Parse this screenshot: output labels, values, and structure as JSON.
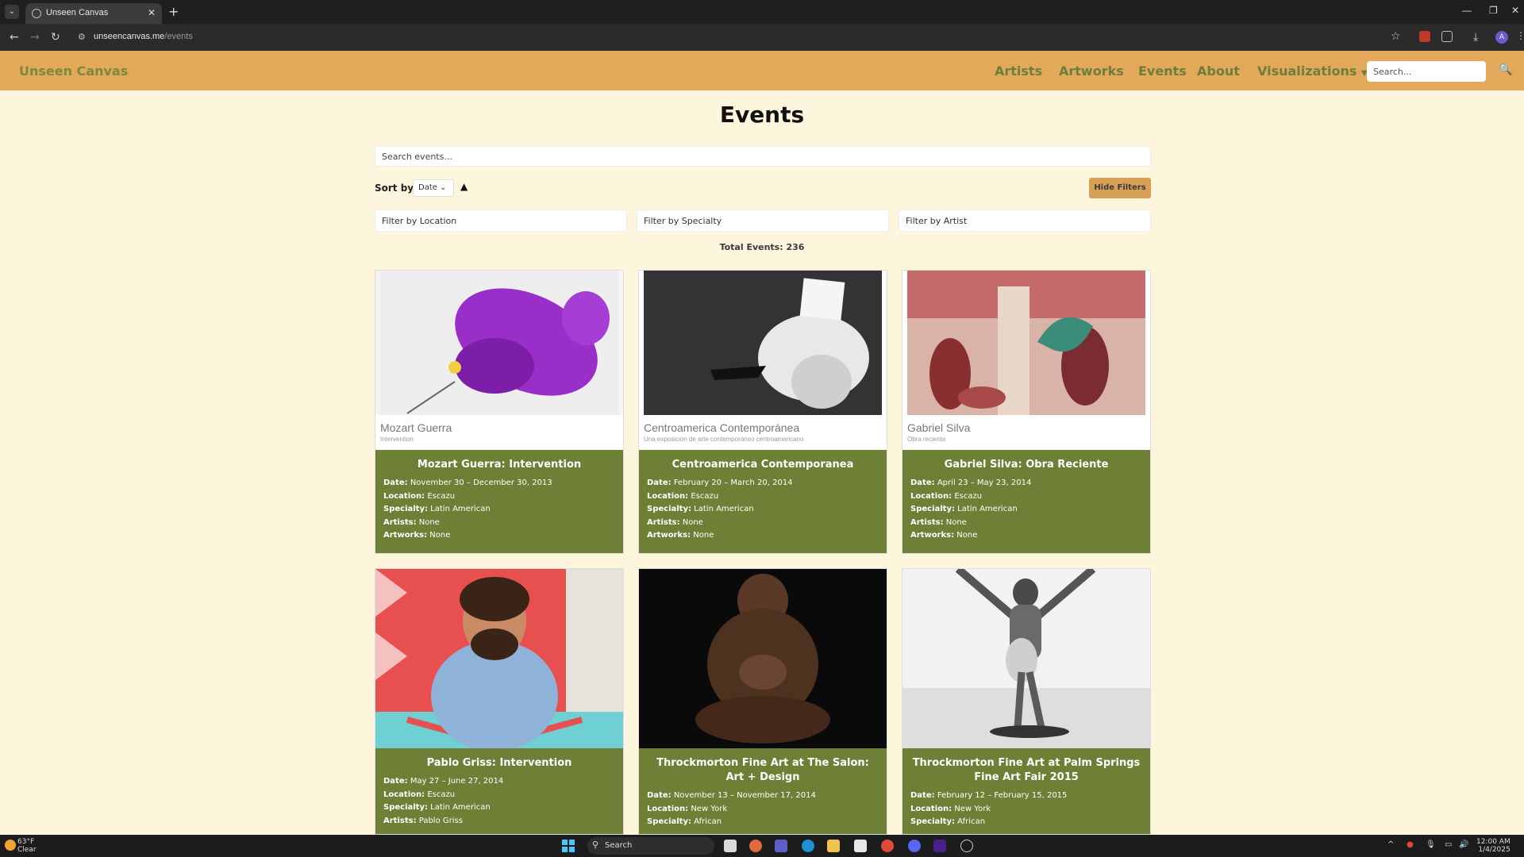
{
  "browser": {
    "tab_title": "Unseen Canvas",
    "url_host": "unseencanvas.me",
    "url_path": "/events"
  },
  "navbar": {
    "brand": "Unseen Canvas",
    "links": [
      "Artists",
      "Artworks",
      "Events",
      "About",
      "Visualizations"
    ],
    "search_placeholder": "Search..."
  },
  "page": {
    "title": "Events",
    "search_placeholder": "Search events...",
    "sort_label": "Sort by",
    "sort_value": "Date",
    "sort_direction": "▲",
    "hide_filters": "Hide Filters",
    "filters": [
      "Filter by Location",
      "Filter by Specialty",
      "Filter by Artist"
    ],
    "total": "Total Events: 236"
  },
  "labels": {
    "date": "Date:",
    "location": "Location:",
    "specialty": "Specialty:",
    "artists": "Artists:",
    "artworks": "Artworks:"
  },
  "events": [
    {
      "caption_name": "Mozart Guerra",
      "caption_sub": "Intervention",
      "title": "Mozart Guerra: Intervention",
      "date": "November 30 – December 30, 2013",
      "location": "Escazu",
      "specialty": "Latin American",
      "artists": "None",
      "artworks": "None"
    },
    {
      "caption_name": "Centroamerica Contemporánea",
      "caption_sub": "Una exposición de arte contemporáneo centroamericano",
      "title": "Centroamerica Contemporanea",
      "date": "February 20 – March 20, 2014",
      "location": "Escazu",
      "specialty": "Latin American",
      "artists": "None",
      "artworks": "None"
    },
    {
      "caption_name": "Gabriel Silva",
      "caption_sub": "Obra reciente",
      "title": "Gabriel Silva: Obra Reciente",
      "date": "April 23 – May 23, 2014",
      "location": "Escazu",
      "specialty": "Latin American",
      "artists": "None",
      "artworks": "None"
    },
    {
      "title": "Pablo Griss: Intervention",
      "date": "May 27 – June 27, 2014",
      "location": "Escazu",
      "specialty": "Latin American",
      "artists": "Pablo Griss"
    },
    {
      "title": "Throckmorton Fine Art at The Salon: Art + Design",
      "date": "November 13 – November 17, 2014",
      "location": "New York",
      "specialty": "African"
    },
    {
      "title": "Throckmorton Fine Art at Palm Springs Fine Art Fair 2015",
      "date": "February 12 – February 15, 2015",
      "location": "New York",
      "specialty": "African"
    }
  ],
  "taskbar": {
    "temp": "63°F",
    "weather": "Clear",
    "search": "Search",
    "time": "12:00 AM",
    "date": "1/4/2025"
  },
  "colors": {
    "navbar": "#e3a85a",
    "card": "#6e7f36",
    "page_bg": "#fdf6dc",
    "button": "#d8a056"
  }
}
